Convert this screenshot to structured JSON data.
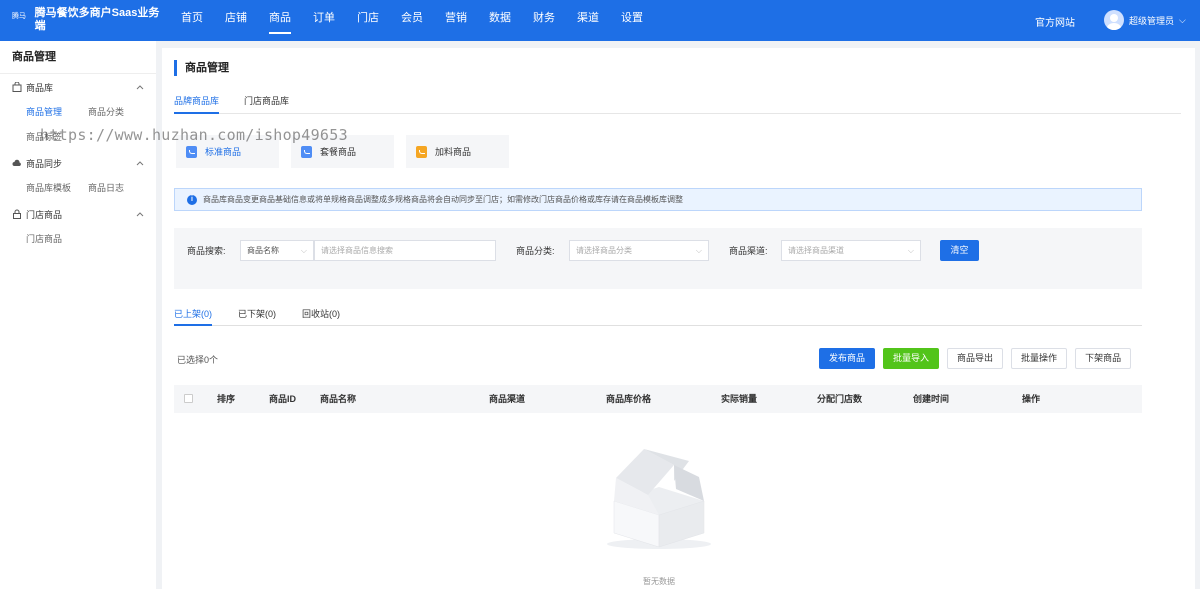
{
  "app": {
    "logo_mark": "腾马",
    "title": "腾马餐饮多商户Saas业务端"
  },
  "nav": {
    "items": [
      "首页",
      "店铺",
      "商品",
      "订单",
      "门店",
      "会员",
      "营销",
      "数据",
      "财务",
      "渠道",
      "设置"
    ],
    "active": "商品",
    "site_link": "官方网站",
    "user_name": "超级管理员",
    "user_chevron": "⌵"
  },
  "sidebar": {
    "title": "商品管理",
    "groups": [
      {
        "label": "商品库",
        "icon": "bag-icon",
        "items": [
          {
            "label": "商品管理",
            "active": true
          },
          {
            "label": "商品分类",
            "active": false
          },
          {
            "label": "商品标签",
            "active": false
          }
        ]
      },
      {
        "label": "商品同步",
        "icon": "cloud-sync-icon",
        "items": [
          {
            "label": "商品库模板",
            "active": false
          },
          {
            "label": "商品日志",
            "active": false
          }
        ]
      },
      {
        "label": "门店商品",
        "icon": "lock-icon",
        "items": [
          {
            "label": "门店商品",
            "active": false
          }
        ]
      }
    ]
  },
  "main": {
    "page_title": "商品管理",
    "lib_tabs": [
      {
        "label": "品牌商品库",
        "active": true
      },
      {
        "label": "门店商品库",
        "active": false
      }
    ],
    "type_cards": [
      {
        "label": "标准商品",
        "icon": "bag-icon",
        "active": true
      },
      {
        "label": "套餐商品",
        "icon": "bag-icon",
        "active": false
      },
      {
        "label": "加料商品",
        "icon": "bottle-icon",
        "active": false
      }
    ],
    "notice": "商品库商品变更商品基础信息或将单规格商品调整成多规格商品将会自动同步至门店；如需修改门店商品价格或库存请在商品模板库调整",
    "filter": {
      "search_label": "商品搜索:",
      "search_type": "商品名称",
      "search_placeholder": "请选择商品信息搜索",
      "category_label": "商品分类:",
      "category_placeholder": "请选择商品分类",
      "channel_label": "商品渠道:",
      "channel_placeholder": "请选择商品渠道",
      "clear_button": "清空"
    },
    "status_tabs": [
      {
        "label": "已上架(0)",
        "active": true
      },
      {
        "label": "已下架(0)",
        "active": false
      },
      {
        "label": "回收站(0)",
        "active": false
      }
    ],
    "selected_count": "已选择0个",
    "actions": {
      "publish": "发布商品",
      "bulk_import": "批量导入",
      "export": "商品导出",
      "bulk_ops": "批量操作",
      "delist": "下架商品"
    },
    "table_headers": [
      "排序",
      "商品ID",
      "商品名称",
      "商品渠道",
      "商品库价格",
      "实际销量",
      "分配门店数",
      "创建时间",
      "操作"
    ],
    "empty_text": "暂无数据"
  },
  "watermark": "https://www.huzhan.com/ishop49653"
}
